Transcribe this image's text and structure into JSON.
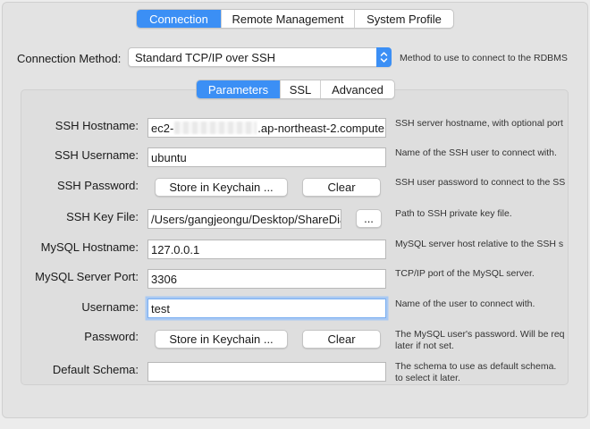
{
  "top_tabs": [
    {
      "label": "Connection",
      "active": true
    },
    {
      "label": "Remote Management",
      "active": false
    },
    {
      "label": "System Profile",
      "active": false
    }
  ],
  "connection_method": {
    "label": "Connection Method:",
    "value": "Standard TCP/IP over SSH",
    "hint": "Method to use to connect to the RDBMS"
  },
  "inner_tabs": [
    {
      "label": "Parameters",
      "active": true
    },
    {
      "label": "SSL",
      "active": false
    },
    {
      "label": "Advanced",
      "active": false
    }
  ],
  "params": {
    "ssh_hostname": {
      "label": "SSH Hostname:",
      "value_prefix": "ec2-",
      "value_suffix": ".ap-northeast-2.compute",
      "hint": "SSH server hostname, with  optional port"
    },
    "ssh_username": {
      "label": "SSH Username:",
      "value": "ubuntu",
      "hint": "Name of the SSH user to connect with."
    },
    "ssh_password": {
      "label": "SSH Password:",
      "store_button": "Store in Keychain ...",
      "clear_button": "Clear",
      "hint": "SSH user password to connect to the SSH"
    },
    "ssh_key_file": {
      "label": "SSH Key File:",
      "value": "/Users/gangjeongu/Desktop/ShareDia",
      "browse_button": "...",
      "hint": "Path to SSH private key file."
    },
    "mysql_hostname": {
      "label": "MySQL Hostname:",
      "value": "127.0.0.1",
      "hint": "MySQL server host relative to the SSH s"
    },
    "mysql_port": {
      "label": "MySQL Server Port:",
      "value": "3306",
      "hint": "TCP/IP port of the MySQL server."
    },
    "username": {
      "label": "Username:",
      "value": "test",
      "hint": "Name of the user to connect with."
    },
    "password": {
      "label": "Password:",
      "store_button": "Store in Keychain ...",
      "clear_button": "Clear",
      "hint_line1": "The MySQL user's password. Will be req",
      "hint_line2": "later if not set."
    },
    "default_schema": {
      "label": "Default Schema:",
      "value": "",
      "hint_line1": "The schema to use as default schema.",
      "hint_line2": "to select it later."
    }
  },
  "colors": {
    "accent": "#3b8ff5",
    "window_bg": "#ececec",
    "focus_ring": "#a9c9f3"
  }
}
